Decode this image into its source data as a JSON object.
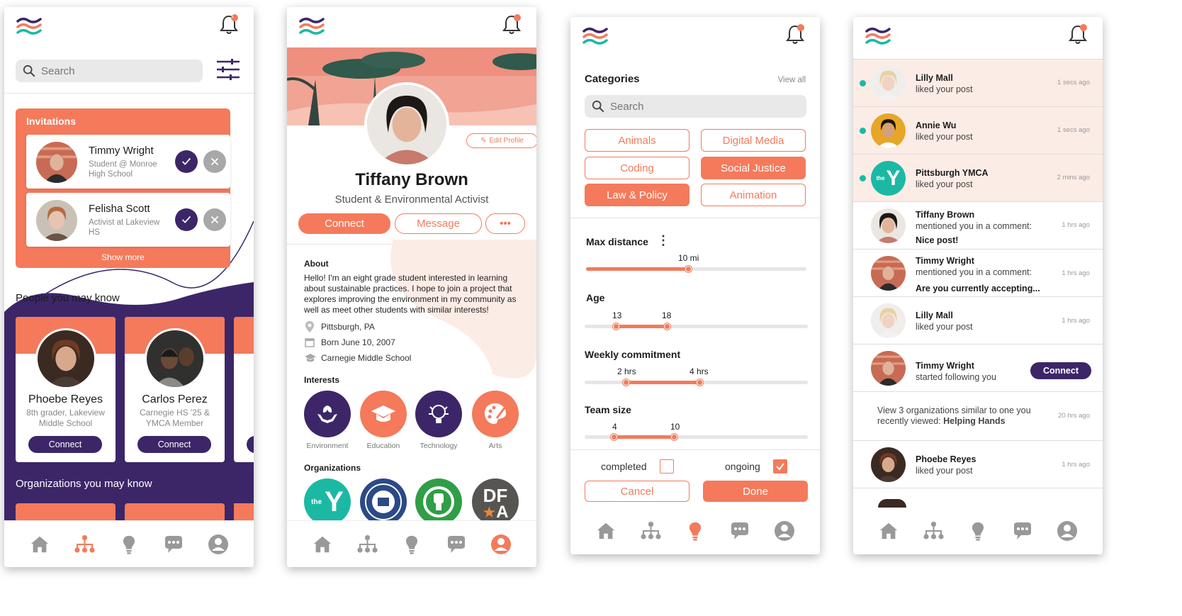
{
  "colors": {
    "accent": "#f47a5b",
    "purple": "#3c2668",
    "teal": "#1bb9a4",
    "highlight": "#fcece6"
  },
  "badge_count": "1",
  "screen1": {
    "search_placeholder": "Search",
    "invitations_title": "Invitations",
    "invitations": [
      {
        "name": "Timmy Wright",
        "subtitle": "Student @ Monroe High School"
      },
      {
        "name": "Felisha Scott",
        "subtitle": "Activist at Lakeview HS"
      }
    ],
    "show_more": "Show more",
    "people_title": "People you may know",
    "people": [
      {
        "name": "Phoebe Reyes",
        "subtitle": "8th grader, Lakeview Middle School",
        "button": "Connect"
      },
      {
        "name": "Carlos Perez",
        "subtitle": "Carnegie HS '25 & YMCA Member",
        "button": "Connect"
      }
    ],
    "orgs_title": "Organizations you may know"
  },
  "screen2": {
    "edit_profile": "Edit Profile",
    "name": "Tiffany Brown",
    "title": "Student & Environmental Activist",
    "connect": "Connect",
    "message": "Message",
    "more": "•••",
    "about_heading": "About",
    "about_text": "Hello! I'm an eight grade student interested in learning about sustainable practices. I hope to join a project that explores improving the environment in my community as well as meet other students with similar interests!",
    "location": "Pittsburgh, PA",
    "born": "Born June 10, 2007",
    "school": "Carnegie Middle School",
    "interests_heading": "Interests",
    "interests": [
      "Environment",
      "Education",
      "Technology",
      "Arts"
    ],
    "orgs_heading": "Organizations",
    "org_labels": {
      "ymca": "the",
      "dfa_top": "DF",
      "dfa_bottom": "A"
    }
  },
  "screen3": {
    "categories_heading": "Categories",
    "view_all": "View all",
    "search_placeholder": "Search",
    "categories": [
      {
        "label": "Animals",
        "selected": false
      },
      {
        "label": "Digital Media",
        "selected": false
      },
      {
        "label": "Coding",
        "selected": false
      },
      {
        "label": "Social Justice",
        "selected": true
      },
      {
        "label": "Law & Policy",
        "selected": true
      },
      {
        "label": "Animation",
        "selected": false
      }
    ],
    "max_distance_label": "Max distance",
    "max_distance_value": "10 mi",
    "age_label": "Age",
    "age_min": "13",
    "age_max": "18",
    "weekly_label": "Weekly commitment",
    "weekly_min": "2 hrs",
    "weekly_max": "4 hrs",
    "team_label": "Team size",
    "team_min": "4",
    "team_max": "10",
    "completed_label": "completed",
    "completed_checked": false,
    "ongoing_label": "ongoing",
    "ongoing_checked": true,
    "cancel": "Cancel",
    "done": "Done"
  },
  "screen4": {
    "notifications": [
      {
        "name": "Lilly Mall",
        "text": "liked your post",
        "time": "1 secs ago"
      },
      {
        "name": "Annie Wu",
        "text": "liked your post",
        "time": "1 secs ago"
      },
      {
        "name": "Pittsburgh YMCA",
        "text": "liked your post",
        "time": "2 mins ago"
      },
      {
        "name": "Tiffany Brown",
        "text": "mentioned you in a comment:",
        "quote": "Nice post!",
        "time": "1 hrs ago"
      },
      {
        "name": "Timmy Wright",
        "text": "mentioned you in a comment:",
        "quote": "Are you currently accepting...",
        "time": "1 hrs ago"
      },
      {
        "name": "Lilly Mall",
        "text": "liked your post",
        "time": "1 hrs ago"
      },
      {
        "name": "Timmy Wright",
        "text": "started following you",
        "button": "Connect"
      },
      {
        "text_prefix": "View 3 organizations similar to one you recently viewed: ",
        "text_bold": "Helping Hands",
        "time": "20 hrs ago"
      },
      {
        "name": "Phoebe Reyes",
        "text": "liked your post",
        "time": "1 hrs ago"
      }
    ],
    "ymca_label": "the"
  }
}
